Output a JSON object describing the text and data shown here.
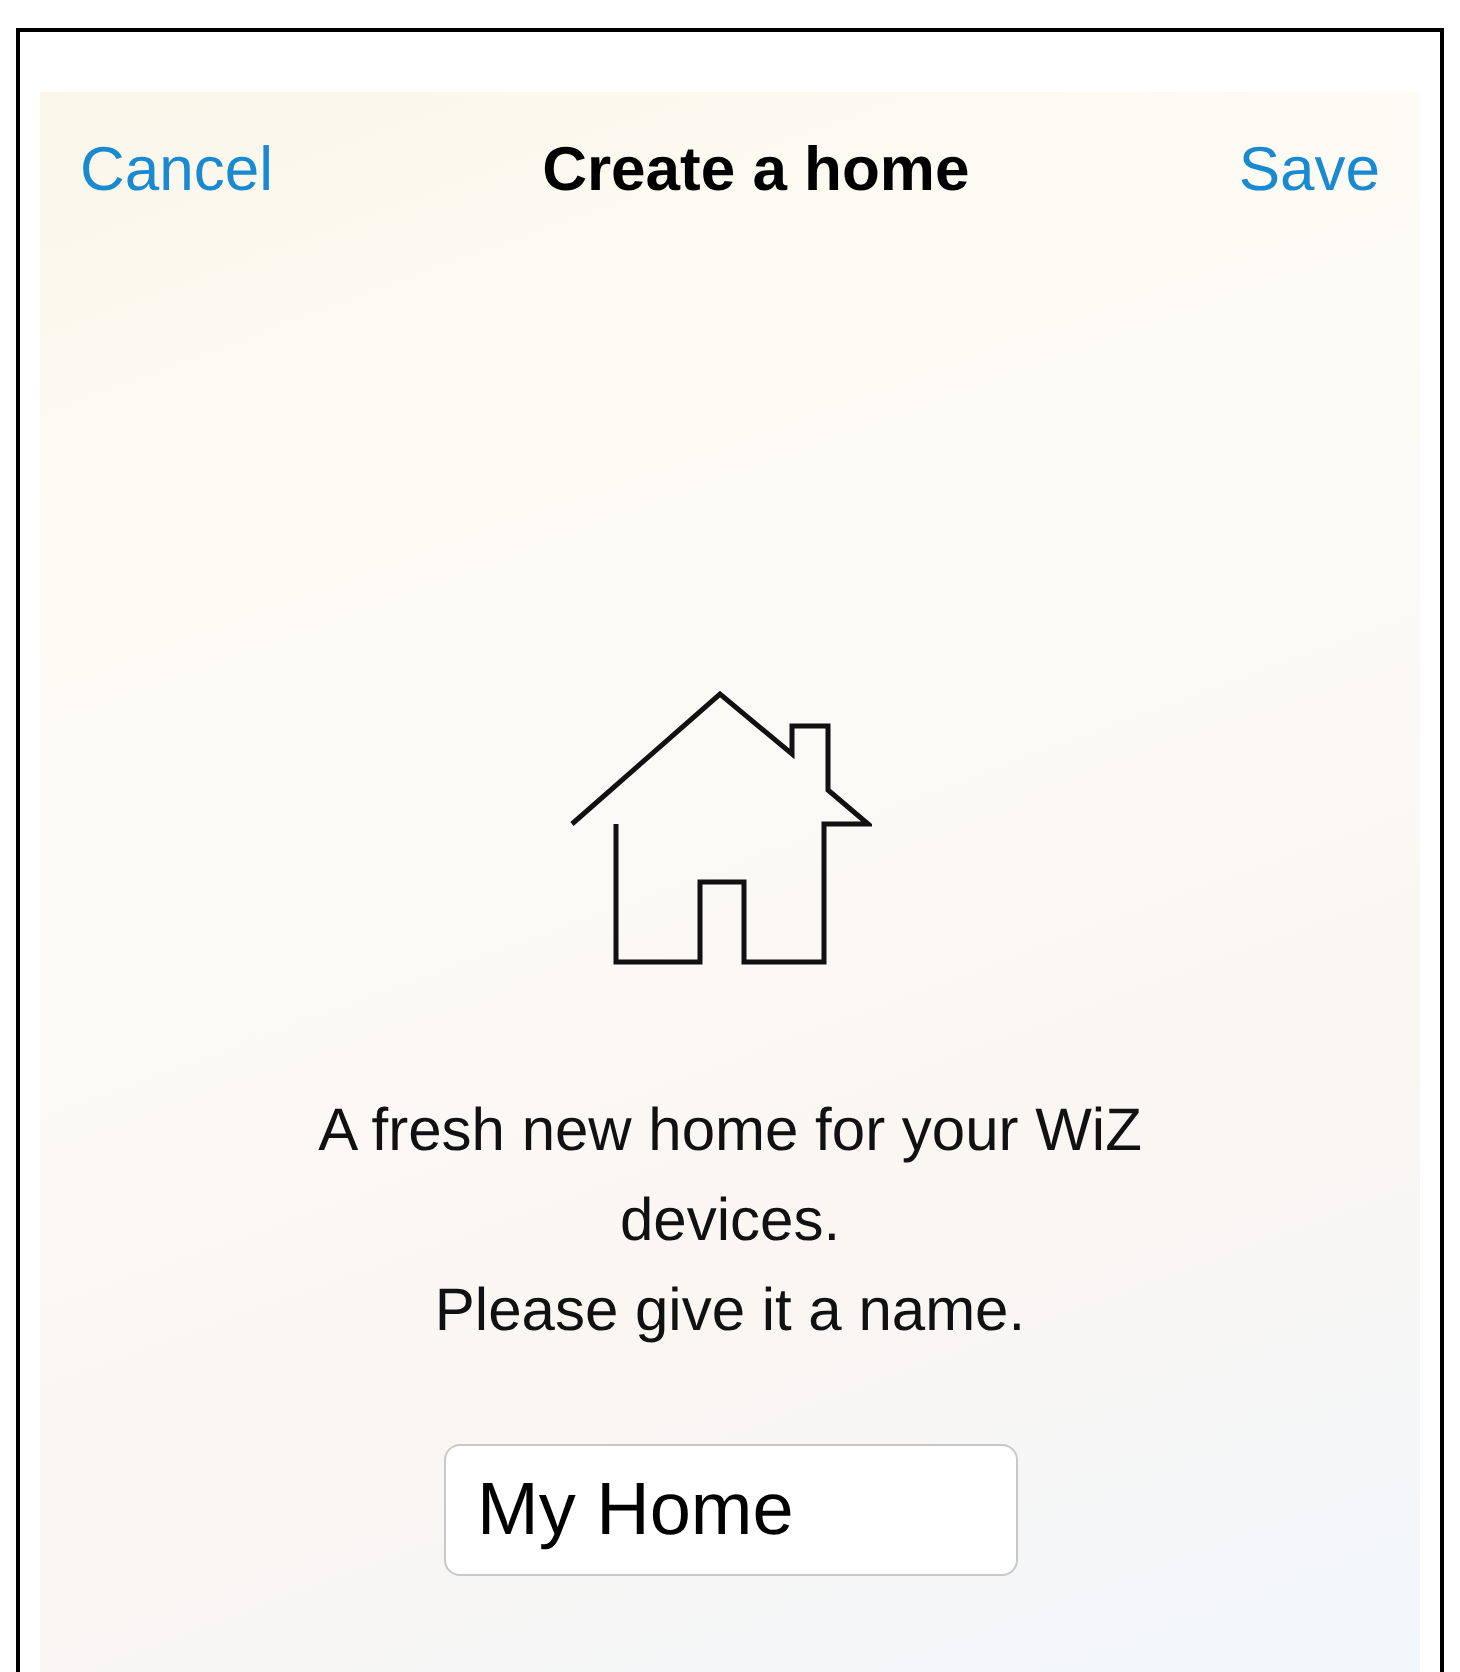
{
  "nav": {
    "cancel": "Cancel",
    "title": "Create a home",
    "save": "Save"
  },
  "description": "A fresh new home for your WiZ devices.",
  "instruction": "Please give it a name.",
  "name_field": {
    "value": "My Home"
  }
}
